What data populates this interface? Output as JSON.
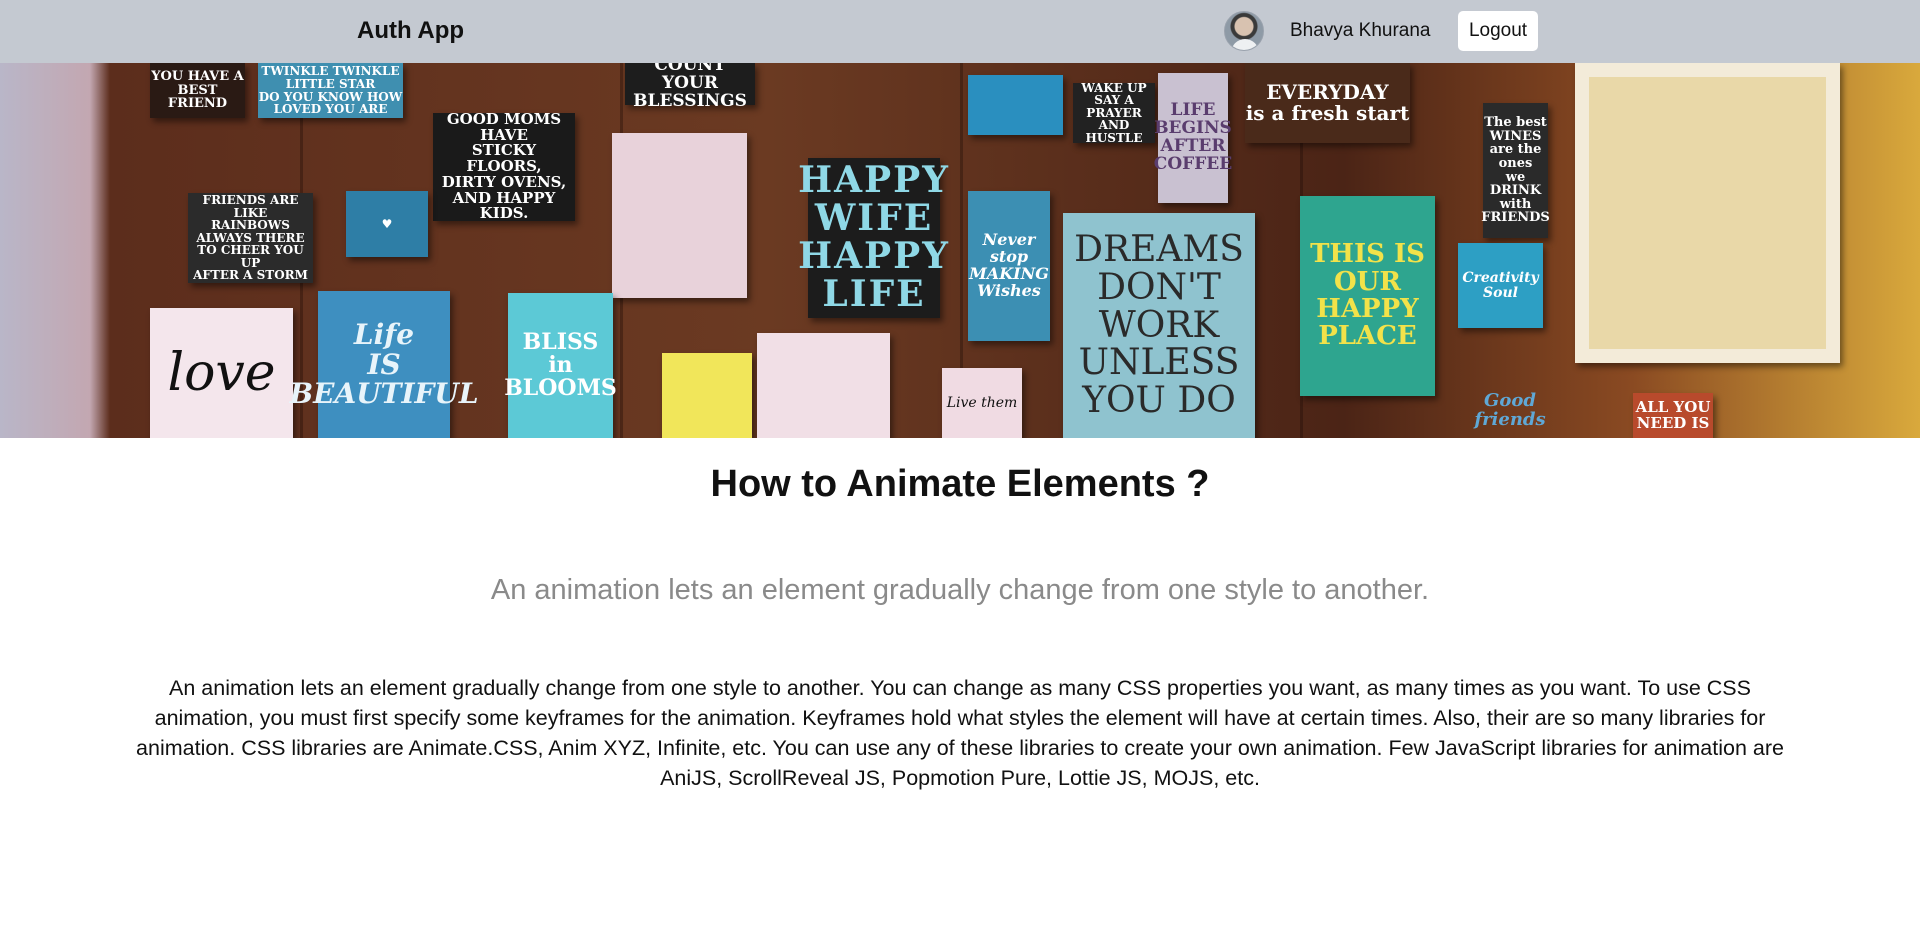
{
  "navbar": {
    "brand": "Auth App",
    "user_name": "Bhavya Khurana",
    "logout_label": "Logout",
    "avatar_icon": "user-avatar-photo",
    "background_color": "#c4c9d1"
  },
  "hero": {
    "image_description_icon": "wall-of-signs-banner",
    "signs": [
      {
        "text": "YOU HAVE A\nBEST FRIEND"
      },
      {
        "text": "TWINKLE TWINKLE\nLITTLE STAR\nDO YOU KNOW HOW\nLOVED YOU ARE"
      },
      {
        "text": "COUNT YOUR\nBLESSINGS"
      },
      {
        "text": "GOOD MOMS HAVE\nSTICKY FLOORS,\nDIRTY OVENS,\nAND HAPPY KIDS."
      },
      {
        "text": "FRIENDS ARE LIKE\nRAINBOWS\nALWAYS THERE\nTO CHEER YOU UP\nAFTER A STORM"
      },
      {
        "text": "HAPPY\nWIFE\nHAPPY\nLIFE"
      },
      {
        "text": "WAKE UP\nSAY A PRAYER\nAND HUSTLE"
      },
      {
        "text": "LIFE\nBEGINS\nAFTER\nCOFFEE"
      },
      {
        "text": "EVERYDAY\nis a fresh start"
      },
      {
        "text": "The best\nWINES\nare the ones\nwe DRINK\nwith\nFRIENDS"
      },
      {
        "text": "DREAMS\nDON'T\nWORK\nUNLESS\nYOU DO"
      },
      {
        "text": "THIS IS\nOUR\nHAPPY\nPLACE"
      },
      {
        "text": "Creativity\nSoul"
      },
      {
        "text": "love"
      },
      {
        "text": "Life\nIS\nBEAUTIFUL"
      },
      {
        "text": "BLISS\nin\nBLOOMS"
      },
      {
        "text": "Never\nstop\nMAKING\nWishes"
      },
      {
        "text": "Live them"
      },
      {
        "text": "ALL YOU\nNEED IS"
      },
      {
        "text": "Good\nfriends"
      }
    ]
  },
  "article": {
    "title": "How to Animate Elements ?",
    "subtitle": "An animation lets an element gradually change from one style to another.",
    "body": "An animation lets an element gradually change from one style to another. You can change as many CSS properties you want, as many times as you want. To use CSS animation, you must first specify some keyframes for the animation. Keyframes hold what styles the element will have at certain times. Also, their are so many libraries for animation. CSS libraries are Animate.CSS, Anim XYZ, Infinite, etc. You can use any of these libraries to create your own animation. Few JavaScript libraries for animation are AniJS, ScrollReveal JS, Popmotion Pure, Lottie JS, MOJS, etc."
  }
}
